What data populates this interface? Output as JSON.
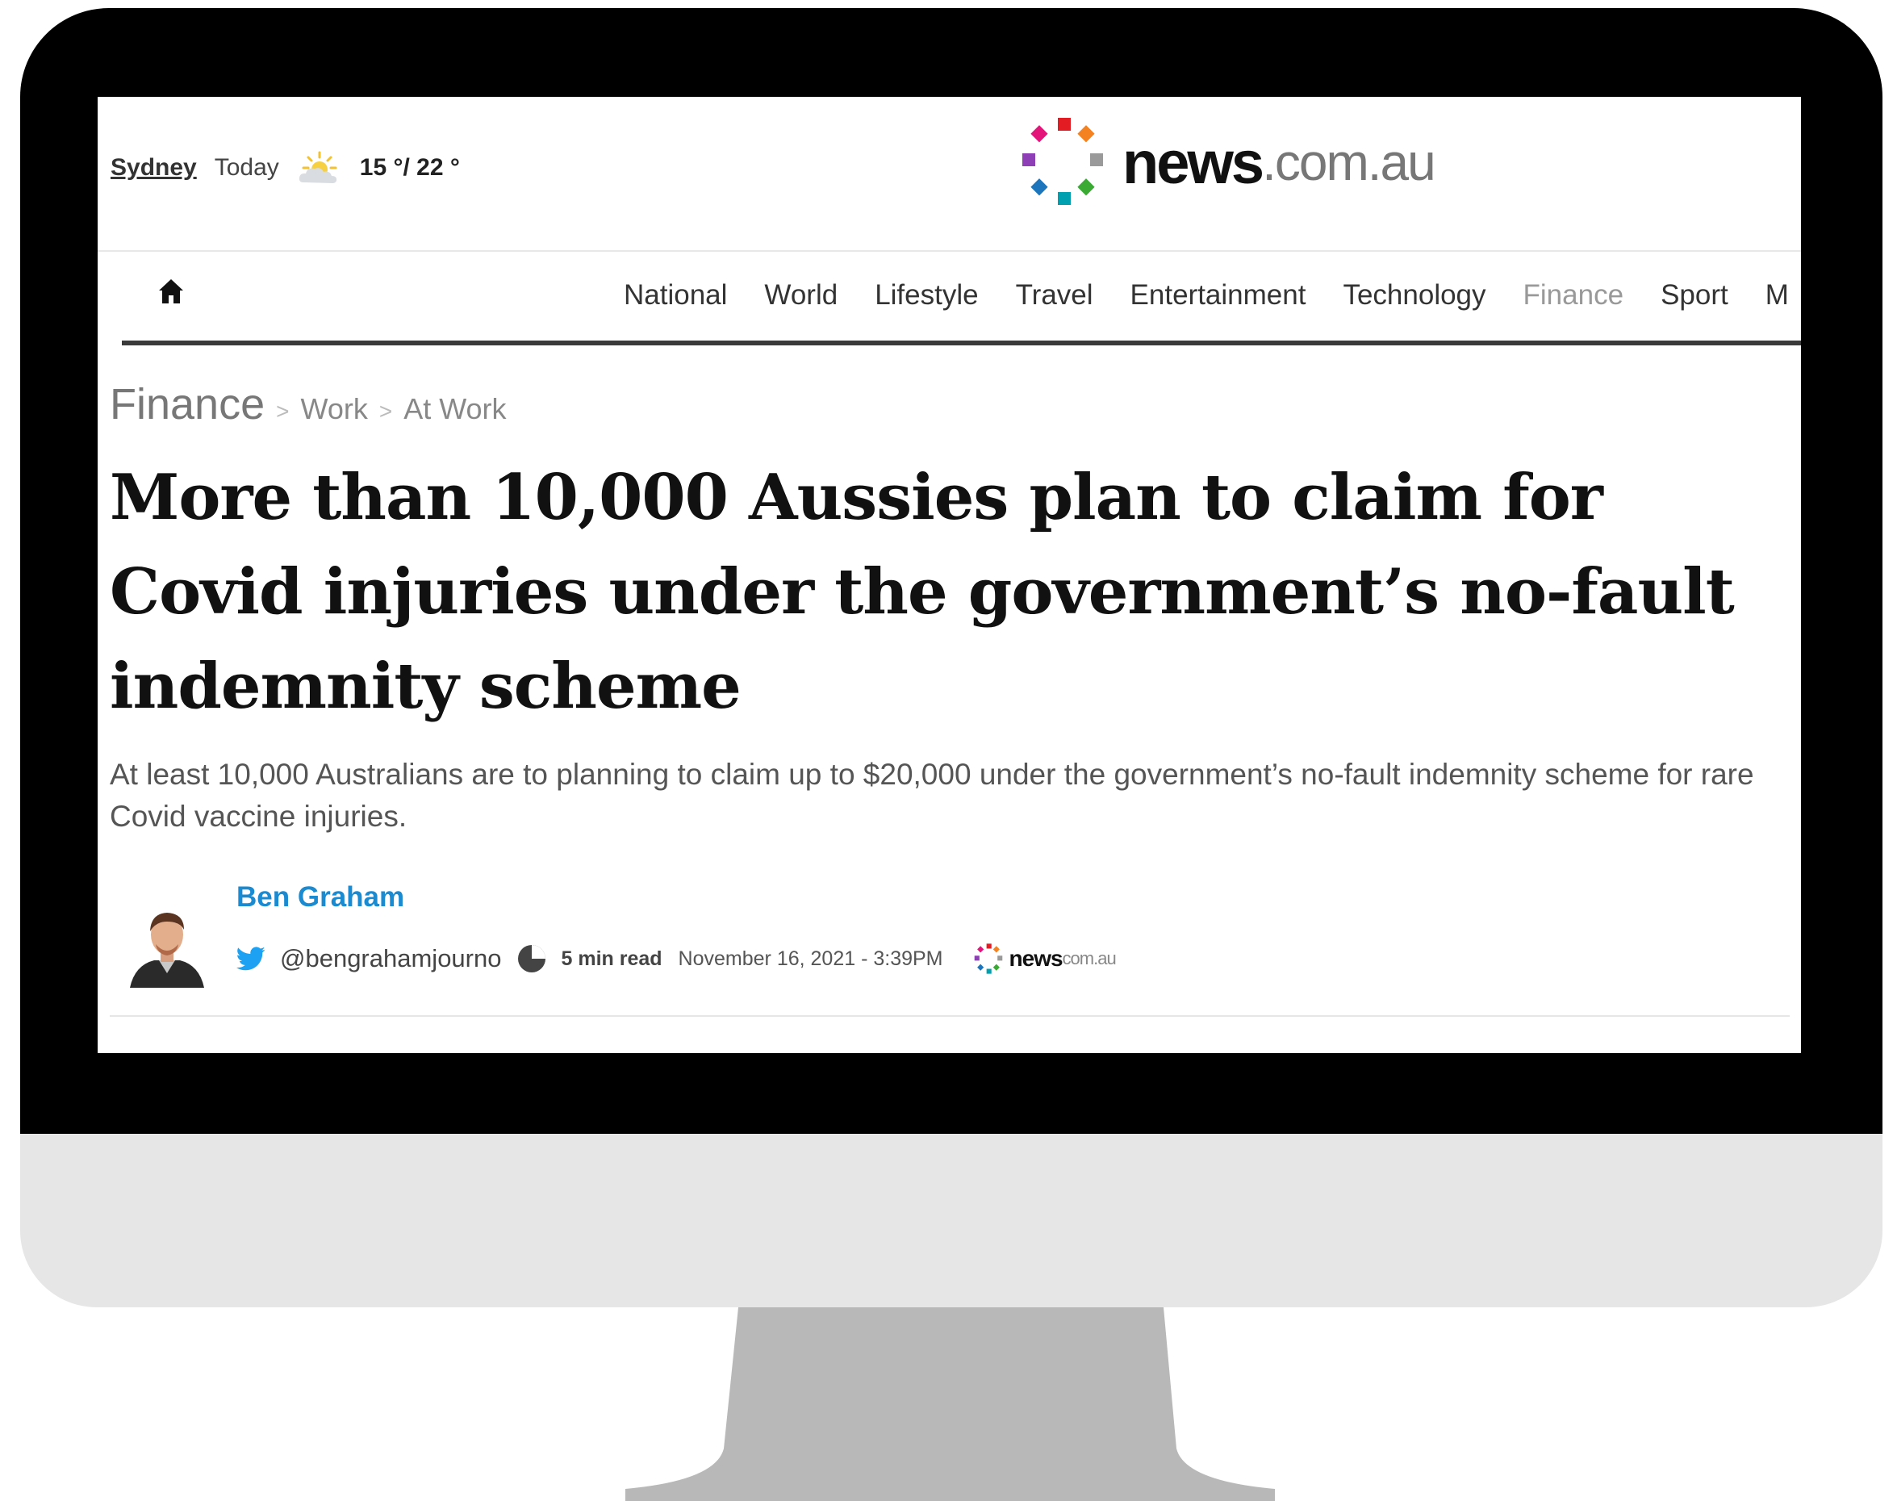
{
  "topbar": {
    "city": "Sydney",
    "day": "Today",
    "weather_icon": "partly-cloudy-icon",
    "temps": "15 °/ 22 °"
  },
  "logo": {
    "word": "news",
    "domain": ".com.au"
  },
  "nav": {
    "home_icon": "home-icon",
    "items": [
      "National",
      "World",
      "Lifestyle",
      "Travel",
      "Entertainment",
      "Technology",
      "Finance",
      "Sport",
      "M"
    ],
    "active": "Finance"
  },
  "breadcrumb": {
    "section": "Finance",
    "sep": ">",
    "items": [
      "Work",
      "At Work"
    ]
  },
  "article": {
    "headline": "More than 10,000 Aussies plan to claim for Covid injuries under the government’s no-fault indemnity scheme",
    "standfirst": "At least 10,000 Australians are to planning to claim up to $20,000 under the government’s no-fault indemnity scheme for rare Covid vaccine injuries.",
    "author": "Ben Graham",
    "twitter_handle": "@bengrahamjourno",
    "read_time": "5 min read",
    "date": "November 16, 2021 - 3:39PM",
    "source_logo": {
      "word": "news",
      "domain": "com.au"
    }
  },
  "colors": {
    "author_link": "#1a8ad1",
    "bezel": "#000000",
    "chin": "#e6e6e6",
    "stand": "#b8b8b8"
  }
}
